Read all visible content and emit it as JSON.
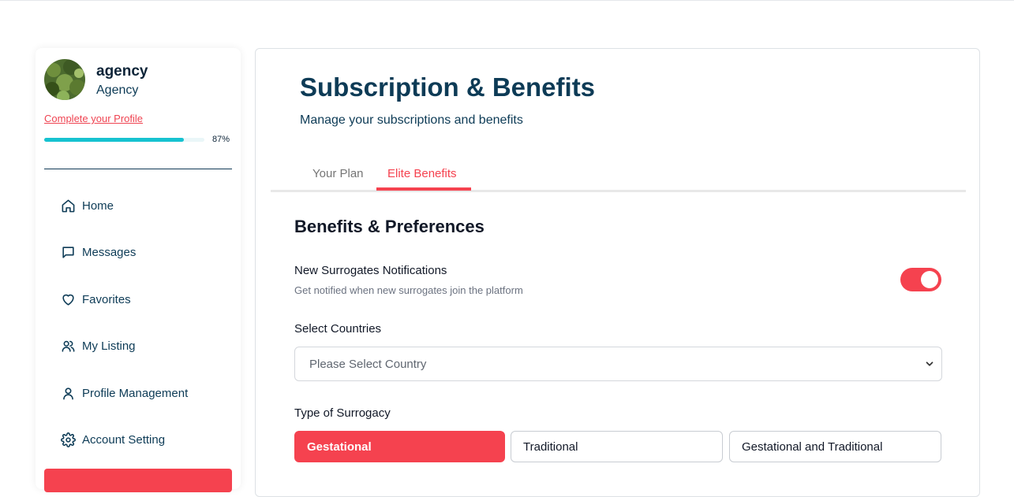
{
  "profile": {
    "name": "agency",
    "role": "Agency",
    "complete_link": "Complete your Profile",
    "progress_pct": 87,
    "progress_label": "87%"
  },
  "nav": {
    "items": [
      {
        "label": "Home",
        "icon": "home-icon"
      },
      {
        "label": "Messages",
        "icon": "message-icon"
      },
      {
        "label": "Favorites",
        "icon": "heart-icon"
      },
      {
        "label": "My Listing",
        "icon": "users-icon"
      },
      {
        "label": "Profile Management",
        "icon": "user-icon"
      },
      {
        "label": "Account Setting",
        "icon": "gear-icon"
      }
    ]
  },
  "page": {
    "title": "Subscription & Benefits",
    "subtitle": "Manage your subscriptions and benefits"
  },
  "tabs": [
    {
      "label": "Your Plan",
      "active": false
    },
    {
      "label": "Elite Benefits",
      "active": true
    }
  ],
  "benefits": {
    "section_title": "Benefits & Preferences",
    "notifications": {
      "title": "New Surrogates Notifications",
      "description": "Get notified when new surrogates join the platform",
      "enabled": true
    },
    "countries": {
      "label": "Select Countries",
      "placeholder": "Please Select Country"
    },
    "surrogacy": {
      "label": "Type of Surrogacy",
      "options": [
        "Gestational",
        "Traditional",
        "Gestational and Traditional"
      ],
      "selected": "Gestational"
    }
  },
  "colors": {
    "accent": "#f5424f",
    "navy": "#0d3b56",
    "progress": "#16c2d0"
  }
}
